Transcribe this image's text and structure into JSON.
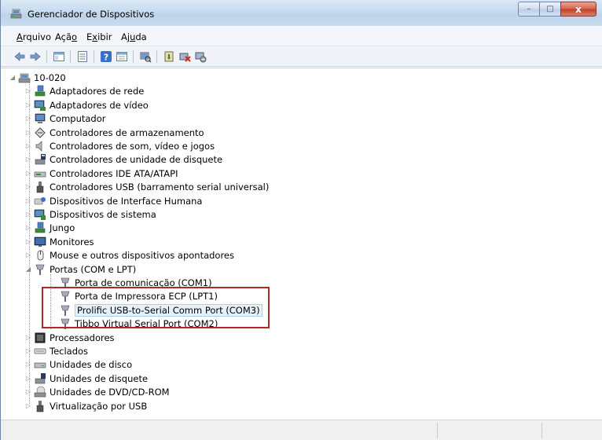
{
  "window": {
    "title": "Gerenciador de Dispositivos",
    "caption": {
      "minimize": "–",
      "maximize": "□",
      "close": "x"
    }
  },
  "menu": [
    {
      "text": "Arquivo",
      "underline": "A",
      "rest": "rquivo"
    },
    {
      "text": "Ação",
      "pre": "Açã",
      "underline": "o",
      "rest": ""
    },
    {
      "text": "Exibir",
      "pre": "E",
      "underline": "x",
      "rest": "ibir"
    },
    {
      "text": "Ajuda",
      "pre": "Aj",
      "underline": "u",
      "rest": "da"
    }
  ],
  "toolbar": [
    "back-icon",
    "forward-icon",
    "properties-grid-icon",
    "console-tree-icon",
    "help-icon",
    "details-icon",
    "scan-hardware-icon",
    "update-driver-icon",
    "uninstall-icon",
    "disable-icon"
  ],
  "tree": {
    "root": "10-020",
    "categories": [
      {
        "label": "Adaptadores de rede",
        "icon": "network-adapter-icon"
      },
      {
        "label": "Adaptadores de vídeo",
        "icon": "display-adapter-icon"
      },
      {
        "label": "Computador",
        "icon": "computer-icon"
      },
      {
        "label": "Controladores de armazenamento",
        "icon": "storage-controller-icon"
      },
      {
        "label": "Controladores de som, vídeo e jogos",
        "icon": "speaker-icon"
      },
      {
        "label": "Controladores de unidade de disquete",
        "icon": "floppy-controller-icon"
      },
      {
        "label": "Controladores IDE ATA/ATAPI",
        "icon": "ide-controller-icon"
      },
      {
        "label": "Controladores USB (barramento serial universal)",
        "icon": "usb-icon"
      },
      {
        "label": "Dispositivos de Interface Humana",
        "icon": "hid-icon"
      },
      {
        "label": "Dispositivos de sistema",
        "icon": "system-device-icon"
      },
      {
        "label": "Jungo",
        "icon": "jungo-icon"
      },
      {
        "label": "Monitores",
        "icon": "monitor-icon"
      },
      {
        "label": "Mouse e outros dispositivos apontadores",
        "icon": "mouse-icon"
      },
      {
        "label": "Portas (COM e LPT)",
        "icon": "port-icon",
        "expanded": true
      },
      {
        "label": "Processadores",
        "icon": "processor-icon"
      },
      {
        "label": "Teclados",
        "icon": "keyboard-icon"
      },
      {
        "label": "Unidades de disco",
        "icon": "disk-drive-icon"
      },
      {
        "label": "Unidades de disquete",
        "icon": "floppy-drive-icon"
      },
      {
        "label": "Unidades de DVD/CD-ROM",
        "icon": "dvd-drive-icon"
      },
      {
        "label": "Virtualização por USB",
        "icon": "usb-virtualization-icon"
      }
    ],
    "ports": [
      {
        "label": "Porta de comunicação (COM1)"
      },
      {
        "label": "Porta de Impressora ECP (LPT1)"
      },
      {
        "label": "Prolific USB-to-Serial Comm Port (COM3)",
        "selected": true
      },
      {
        "label": "Tibbo Virtual Serial Port (COM2)"
      }
    ]
  },
  "colors": {
    "highlight_border": "#b5262a",
    "titlebar": "#c7dbef",
    "close_button": "#c1412a"
  }
}
